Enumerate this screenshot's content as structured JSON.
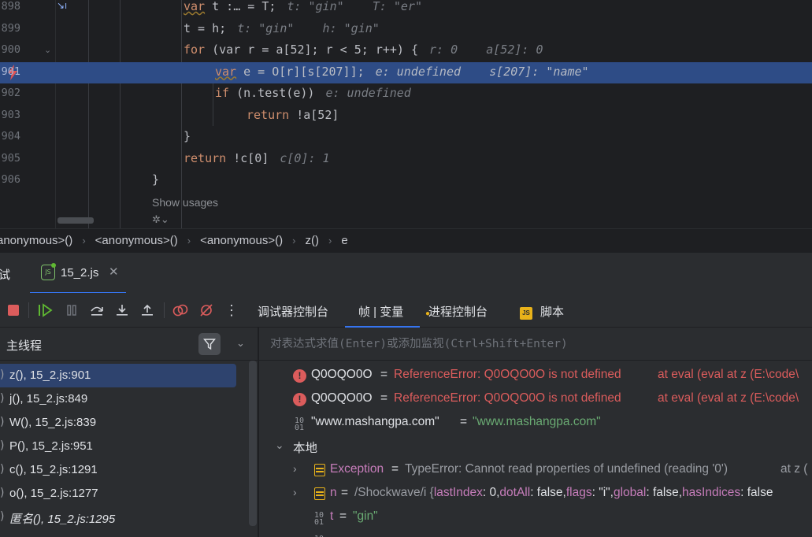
{
  "editor": {
    "lines": [
      {
        "num": "898",
        "kw": "var",
        "code": " t :… = T;",
        "inline": "t: \"gin\"    T: \"er\""
      },
      {
        "num": "899",
        "code": "t = h;",
        "inline": "t: \"gin\"    h: \"gin\""
      },
      {
        "num": "900",
        "code": " (var r = a[52]; r < 5; r++) {",
        "kw": "for",
        "inline": "r: 0    a[52]: 0"
      },
      {
        "num": "901",
        "kw": "var",
        "code": " e = O[r][s[207]];",
        "inline": "e: undefined    s[207]: \"name\""
      },
      {
        "num": "902",
        "kw": "if",
        "code": " (n.test(e))",
        "inline": "e: undefined"
      },
      {
        "num": "903",
        "kw": "return",
        "code": " !a[52]",
        "inline": ""
      },
      {
        "num": "904",
        "code": "}",
        "inline": ""
      },
      {
        "num": "905",
        "kw": "return",
        "code": " !c[0]",
        "inline": "c[0]: 1"
      },
      {
        "num": "906",
        "code": "}",
        "inline": ""
      }
    ],
    "show_usages": "Show usages"
  },
  "breadcrumb": [
    "anonymous>()",
    "<anonymous>()",
    "<anonymous>()",
    "z()",
    "e"
  ],
  "toolwindow": {
    "title": "试",
    "tab_label": "15_2.js",
    "js_icon": "JS",
    "tabs": [
      "调试器控制台",
      "帧 | 变量",
      "进程控制台",
      "脚本"
    ],
    "js_badge": "JS"
  },
  "frames": {
    "thread": "主线程",
    "items": [
      {
        "label": "z(), 15_2.js:901"
      },
      {
        "label": "j(), 15_2.js:849"
      },
      {
        "label": "W(), 15_2.js:839"
      },
      {
        "label": "P(), 15_2.js:951"
      },
      {
        "label": "c(), 15_2.js:1291"
      },
      {
        "label": "o(), 15_2.js:1277"
      },
      {
        "label": "匿名(), 15_2.js:1295"
      }
    ]
  },
  "variables": {
    "eval_placeholder": "对表达式求值(Enter)或添加监视(Ctrl+Shift+Enter)",
    "watch1": {
      "name": "Q0OQO0O",
      "eq": "=",
      "value": "ReferenceError: Q0OQO0O is not defined",
      "extra": "at eval (eval at z (E:\\code\\"
    },
    "watch2": {
      "name": "Q0OQO0O",
      "eq": "=",
      "value": "ReferenceError: Q0OQO0O is not defined",
      "extra": "at eval (eval at z (E:\\code\\"
    },
    "watch3": {
      "name": "\"www.mashangpa.com\"",
      "eq": "=",
      "value": "\"www.mashangpa.com\""
    },
    "local_label": "本地",
    "exception": {
      "name": "Exception",
      "eq": "=",
      "value": "TypeError: Cannot read properties of undefined (reading '0')",
      "extra": "at z ("
    },
    "n": {
      "name": "n",
      "eq": "=",
      "value": "/Shockwave/i",
      "p1": "lastIndex",
      "v1": ": 0,",
      "p2": "dotAll",
      "v2": ": false,",
      "p3": "flags",
      "v3": ": \"i\",",
      "p4": "global",
      "v4": ": false,",
      "p5": "hasIndices",
      "v5": ": false"
    },
    "t": {
      "name": "t",
      "eq": "=",
      "value": "\"gin\""
    }
  }
}
